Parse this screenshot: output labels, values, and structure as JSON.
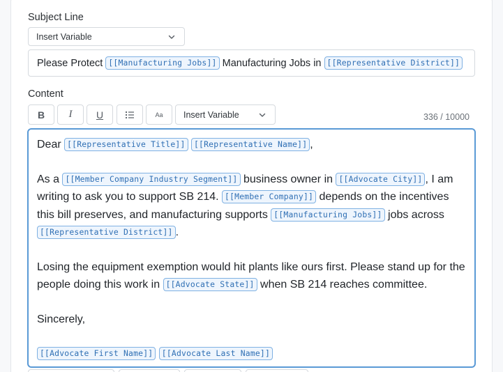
{
  "subject": {
    "label": "Subject Line",
    "insert_variable": "Insert Variable",
    "text_1": "Please Protect ",
    "var_1": "[[Manufacturing Jobs]]",
    "text_2": " Manufacturing Jobs in ",
    "var_2": "[[Representative District]]"
  },
  "content": {
    "label": "Content",
    "toolbar": {
      "bold": "B",
      "italic": "I",
      "underline": "U",
      "list_icon": "bulleted-list-icon",
      "text_size": "Aa",
      "insert_variable": "Insert Variable"
    },
    "counter": "336 / 10000",
    "body": {
      "greeting_prefix": "Dear ",
      "rep_title": "[[Representative Title]]",
      "rep_name": "[[Representative Name]]",
      "greeting_suffix": ",",
      "p1_a": "As a ",
      "segment": "[[Member Company Industry Segment]]",
      "p1_b": " business owner in ",
      "city": "[[Advocate City]]",
      "p1_c": ", I am writing to ask you to support SB 214. ",
      "company": "[[Member Company]]",
      "p1_d": " depends on the incentives this bill preserves, and manufacturing supports ",
      "jobs": "[[Manufacturing Jobs]]",
      "p1_e": " jobs across ",
      "district": "[[Representative District]]",
      "p1_f": ".",
      "p2_a": "Losing the equipment exemption would hit plants like ours first. Please stand up for the people doing this work in ",
      "state": "[[Advocate State]]",
      "p2_b": " when SB 214 reaches committee.",
      "closing": "Sincerely,",
      "first_name": "[[Advocate First Name]]",
      "last_name": "[[Advocate Last Name]]"
    }
  },
  "colors": {
    "variable_chip_text": "#2f6fb4",
    "variable_chip_border": "#7fb1e3",
    "editor_focus_border": "#5a9ad6"
  }
}
